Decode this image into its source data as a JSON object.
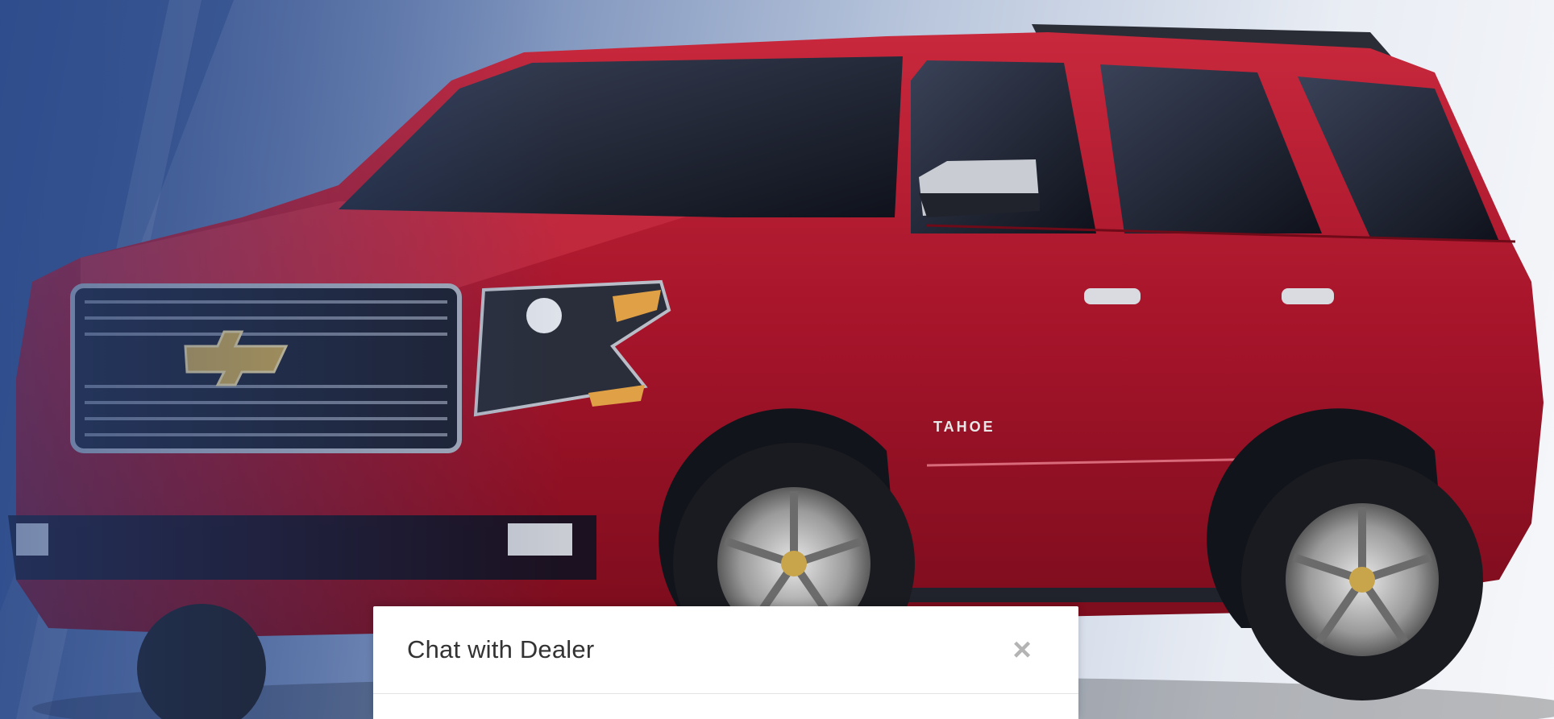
{
  "hero": {
    "image_alt": "Red Chevrolet Tahoe SUV",
    "badge_text": "TAHOE",
    "body_color": "#b3162c",
    "background_accent": "#3b5590"
  },
  "chat": {
    "title": "Chat with Dealer",
    "close_glyph": "×"
  }
}
